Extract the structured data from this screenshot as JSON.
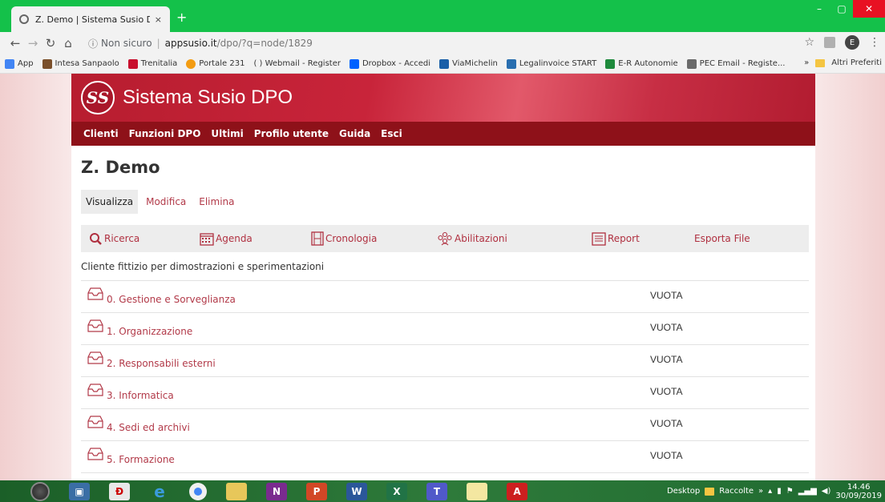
{
  "browser": {
    "tab_title": "Z. Demo | Sistema Susio DPO",
    "tab_close": "×",
    "new_tab": "+",
    "window_controls": [
      "–",
      "▢",
      "✕"
    ],
    "security_label": "Non sicuro",
    "url_host": "appsusio.it",
    "url_path": "/dpo/?q=node/1829",
    "profile_initial": "E",
    "bookmarks": [
      {
        "label": "App",
        "icon": "apps-grid-icon",
        "color": "#4285f4"
      },
      {
        "label": "Intesa Sanpaolo",
        "icon": "intesa-icon",
        "color": "#7a4f2a"
      },
      {
        "label": "Trenitalia",
        "icon": "trenitalia-icon",
        "color": "#c8102e"
      },
      {
        "label": "Portale 231",
        "icon": "portale-icon",
        "color": "#f39c12"
      },
      {
        "label": "( ) Webmail - Register",
        "icon": "",
        "color": ""
      },
      {
        "label": "Dropbox - Accedi",
        "icon": "dropbox-icon",
        "color": "#0061ff"
      },
      {
        "label": "ViaMichelin",
        "icon": "viamichelin-icon",
        "color": "#1a5fa8"
      },
      {
        "label": "Legalinvoice START",
        "icon": "legalinvoice-icon",
        "color": "#2a6fb0"
      },
      {
        "label": "E-R Autonomie",
        "icon": "er-icon",
        "color": "#1e8a3c"
      },
      {
        "label": "PEC Email - Registe...",
        "icon": "pec-icon",
        "color": "#6a6a6a"
      }
    ],
    "bookmarks_overflow": "»",
    "other_bookmarks": "Altri Preferiti"
  },
  "site": {
    "logo_text": "SS",
    "title": "Sistema Susio DPO",
    "menu": [
      "Clienti",
      "Funzioni DPO",
      "Ultimi",
      "Profilo utente",
      "Guida",
      "Esci"
    ]
  },
  "node": {
    "title": "Z. Demo",
    "tabs": [
      {
        "label": "Visualizza",
        "active": true
      },
      {
        "label": "Modifica",
        "active": false
      },
      {
        "label": "Elimina",
        "active": false
      }
    ],
    "toolbar": {
      "ricerca": "Ricerca",
      "agenda": "Agenda",
      "cronologia": "Cronologia",
      "abilitazioni": "Abilitazioni",
      "report": "Report",
      "esporta": "Esporta File"
    },
    "description": "Cliente fittizio per dimostrazioni e sperimentazioni",
    "rows": [
      {
        "label": "0. Gestione e Sorveglianza",
        "status": "VUOTA"
      },
      {
        "label": "1. Organizzazione",
        "status": "VUOTA"
      },
      {
        "label": "2. Responsabili esterni",
        "status": "VUOTA"
      },
      {
        "label": "3. Informatica",
        "status": "VUOTA"
      },
      {
        "label": "4. Sedi ed archivi",
        "status": "VUOTA"
      },
      {
        "label": "5. Formazione",
        "status": "VUOTA"
      }
    ]
  },
  "taskbar": {
    "desktop_label": "Desktop",
    "raccolte_label": "Raccolte",
    "time": "14.46",
    "date": "30/09/2019"
  },
  "colors": {
    "accent": "#b23a49",
    "menubar": "#8e1119",
    "tabstrip": "#14c14a"
  }
}
